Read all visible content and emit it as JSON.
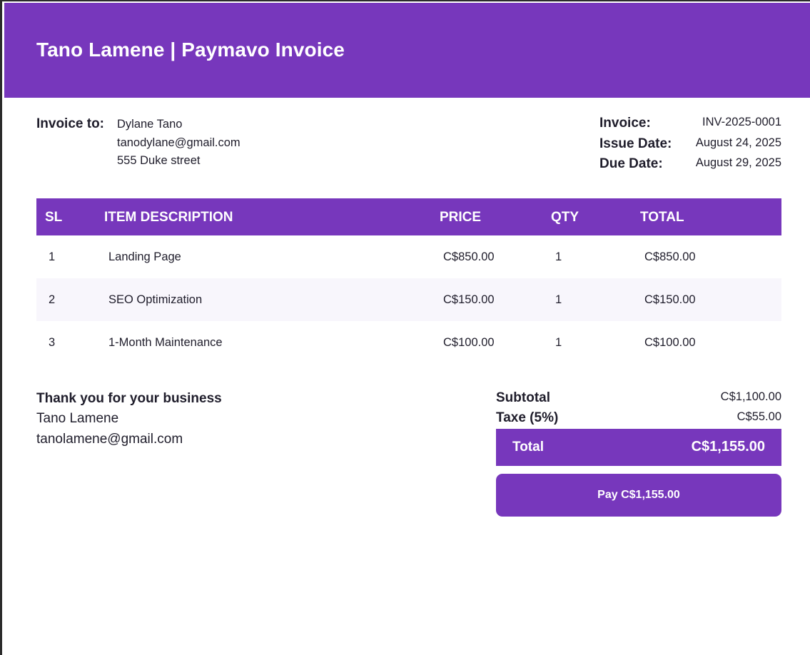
{
  "header": {
    "title": "Tano Lamene | Paymavo Invoice"
  },
  "bill_to": {
    "label": "Invoice to:",
    "name": "Dylane Tano",
    "email": "tanodylane@gmail.com",
    "address": "555 Duke street"
  },
  "meta": {
    "invoice_label": "Invoice:",
    "invoice_value": "INV-2025-0001",
    "issue_label": "Issue Date:",
    "issue_value": "August 24, 2025",
    "due_label": "Due Date:",
    "due_value": "August 29, 2025"
  },
  "table": {
    "headers": {
      "sl": "SL",
      "desc": "ITEM DESCRIPTION",
      "price": "PRICE",
      "qty": "QTY",
      "total": "TOTAL"
    },
    "rows": [
      {
        "sl": "1",
        "desc": "Landing Page",
        "price": "C$850.00",
        "qty": "1",
        "total": "C$850.00"
      },
      {
        "sl": "2",
        "desc": "SEO Optimization",
        "price": "C$150.00",
        "qty": "1",
        "total": "C$150.00"
      },
      {
        "sl": "3",
        "desc": "1-Month Maintenance",
        "price": "C$100.00",
        "qty": "1",
        "total": "C$100.00"
      }
    ]
  },
  "footer": {
    "thanks": "Thank you for your business",
    "sender_name": "Tano Lamene",
    "sender_email": "tanolamene@gmail.com"
  },
  "summary": {
    "subtotal_label": "Subtotal",
    "subtotal_value": "C$1,100.00",
    "tax_label": "Taxe (5%)",
    "tax_value": "C$55.00",
    "total_label": "Total",
    "total_value": "C$1,155.00",
    "pay_label": "Pay C$1,155.00"
  },
  "colors": {
    "accent": "#7737bc",
    "row_alt": "#f8f6fc",
    "text": "#1f1d2b"
  }
}
